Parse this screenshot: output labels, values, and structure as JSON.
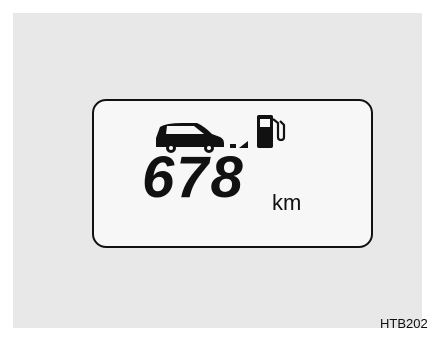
{
  "display": {
    "range_value": "678",
    "range_unit": "km",
    "icons": [
      "car-icon",
      "distance-indicator-icon",
      "fuel-pump-icon"
    ]
  },
  "figure": {
    "code": "HTB202"
  },
  "colors": {
    "background": "#e8e8e8",
    "lcd_background": "#f7f7f7",
    "ink": "#111111"
  }
}
